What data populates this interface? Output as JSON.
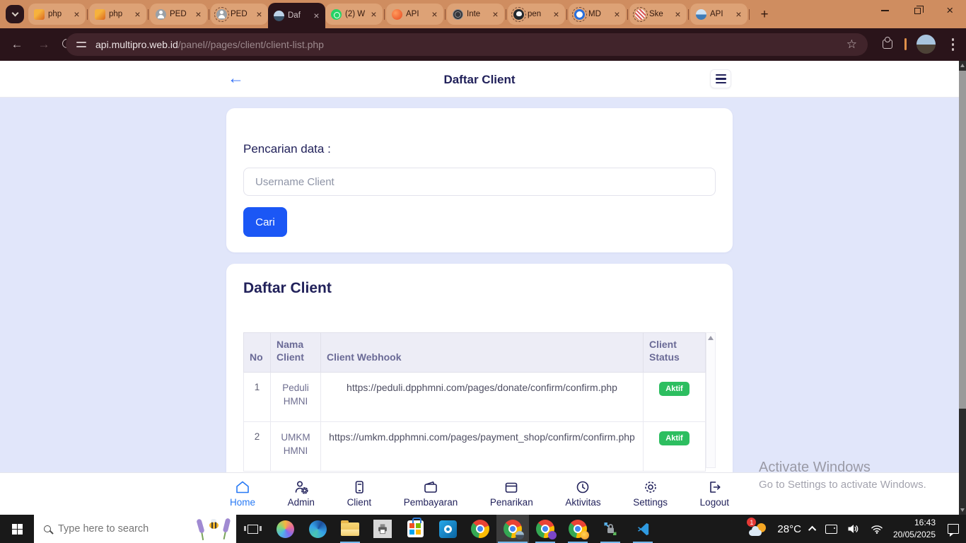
{
  "browser": {
    "tabs": [
      {
        "label": "php",
        "icon": "phpmyadmin-icon"
      },
      {
        "label": "php",
        "icon": "phpmyadmin-icon"
      },
      {
        "label": "PED",
        "icon": "person-icon"
      },
      {
        "label": "PED",
        "icon": "person-dashed-icon"
      },
      {
        "label": "Daf",
        "icon": "photo-favicon",
        "active": true
      },
      {
        "label": "(2) W",
        "icon": "whatsapp-icon"
      },
      {
        "label": "API",
        "icon": "api-orange-icon"
      },
      {
        "label": "Inte",
        "icon": "globe-dark-icon"
      },
      {
        "label": "pen",
        "icon": "github-icon"
      },
      {
        "label": "MD",
        "icon": "blue-ring-icon"
      },
      {
        "label": "Ske",
        "icon": "striped-ring-icon"
      },
      {
        "label": "API",
        "icon": "globe-blue-icon"
      }
    ],
    "url": {
      "host": "api.multipro.web.id",
      "path": "/panel//pages/client/client-list.php"
    }
  },
  "page": {
    "header": {
      "title": "Daftar Client"
    },
    "search": {
      "label": "Pencarian data :",
      "placeholder": "Username Client",
      "button_label": "Cari"
    },
    "table": {
      "title": "Daftar Client",
      "columns": [
        "No",
        "Nama Client",
        "Client Webhook",
        "Client Status"
      ],
      "rows": [
        {
          "no": "1",
          "name": "Peduli HMNI",
          "webhook": "https://peduli.dpphmni.com/pages/donate/confirm/confirm.php",
          "status": "Aktif"
        },
        {
          "no": "2",
          "name": "UMKM HMNI",
          "webhook": "https://umkm.dpphmni.com/pages/payment_shop/confirm/confirm.php",
          "status": "Aktif"
        }
      ]
    },
    "nav": {
      "items": [
        {
          "label": "Home",
          "icon": "home-icon",
          "active": true
        },
        {
          "label": "Admin",
          "icon": "admin-person-gear-icon"
        },
        {
          "label": "Client",
          "icon": "client-phone-icon"
        },
        {
          "label": "Pembayaran",
          "icon": "wallet-icon"
        },
        {
          "label": "Penarikan",
          "icon": "withdraw-box-icon"
        },
        {
          "label": "Aktivitas",
          "icon": "clock-icon"
        },
        {
          "label": "Settings",
          "icon": "gear-icon"
        },
        {
          "label": "Logout",
          "icon": "logout-icon"
        }
      ]
    }
  },
  "watermark": {
    "title": "Activate Windows",
    "subtitle": "Go to Settings to activate Windows."
  },
  "taskbar": {
    "search_placeholder": "Type here to search",
    "apps": [
      "task-view",
      "copilot",
      "edge",
      "file-explorer",
      "printer-app",
      "microsoft-store",
      "outlook",
      "chrome",
      "chrome-active-window",
      "chrome-profile-purple",
      "chrome-profile-fox",
      "remote-access-lock",
      "vscode"
    ],
    "tray": {
      "notification_count": "1",
      "temperature": "28°C",
      "time": "16:43",
      "date": "20/05/2025"
    }
  },
  "colors": {
    "tab_strip": "#cf8d60",
    "toolbar": "#2a141a",
    "body_bg": "#e1e6fa",
    "accent_blue": "#1b57f5",
    "nav_active_blue": "#2779f5",
    "badge_green": "#2dbe60",
    "navy_text": "#21215a"
  }
}
